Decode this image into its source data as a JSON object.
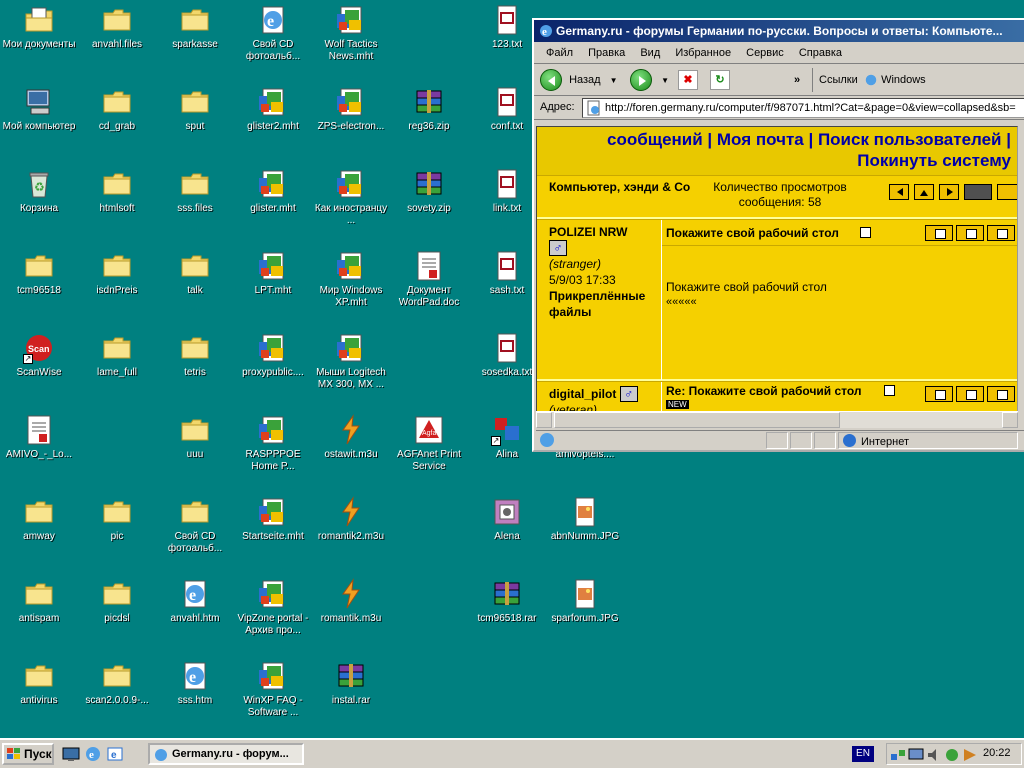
{
  "desktop": {
    "icons": [
      {
        "label": "Мои документы",
        "type": "mydocs"
      },
      {
        "label": "anvahl.files",
        "type": "folder"
      },
      {
        "label": "sparkasse",
        "type": "folder"
      },
      {
        "label": "Свой CD фотоальб...",
        "type": "ie"
      },
      {
        "label": "Wolf Tactics News.mht",
        "type": "mht"
      },
      {
        "label": "123.txt",
        "type": "txt"
      },
      {
        "label": "Мой компьютер",
        "type": "mycomp"
      },
      {
        "label": "cd_grab",
        "type": "folder"
      },
      {
        "label": "sput",
        "type": "folder"
      },
      {
        "label": "glister2.mht",
        "type": "mht"
      },
      {
        "label": "ZPS-electron...",
        "type": "mht"
      },
      {
        "label": "reg36.zip",
        "type": "rar"
      },
      {
        "label": "conf.txt",
        "type": "txt"
      },
      {
        "label": "Корзина",
        "type": "recycle"
      },
      {
        "label": "htmlsoft",
        "type": "folder"
      },
      {
        "label": "sss.files",
        "type": "folder"
      },
      {
        "label": "glister.mht",
        "type": "mht"
      },
      {
        "label": "Как иностранцу ...",
        "type": "mht"
      },
      {
        "label": "sovety.zip",
        "type": "rar"
      },
      {
        "label": "link.txt",
        "type": "txt"
      },
      {
        "label": "tcm96518",
        "type": "folder"
      },
      {
        "label": "isdnPreis",
        "type": "folder"
      },
      {
        "label": "talk",
        "type": "folder"
      },
      {
        "label": "LPT.mht",
        "type": "mht"
      },
      {
        "label": "Мир Windows XP.mht",
        "type": "mht"
      },
      {
        "label": "Документ WordPad.doc",
        "type": "doc"
      },
      {
        "label": "sash.txt",
        "type": "txt"
      },
      {
        "label": "ScanWise",
        "type": "scan"
      },
      {
        "label": "lame_full",
        "type": "folder"
      },
      {
        "label": "tetris",
        "type": "folder"
      },
      {
        "label": "proxypublic....",
        "type": "mht"
      },
      {
        "label": "Мыши Logitech MX 300, MX ...",
        "type": "mht"
      },
      {
        "label": "sosedka.txt",
        "type": "txt"
      },
      {
        "label": "AMIVO_-_Lo...",
        "type": "doc"
      },
      {
        "label": "uuu",
        "type": "folder"
      },
      {
        "label": "RASPPPOE Home P...",
        "type": "mht"
      },
      {
        "label": "ostawit.m3u",
        "type": "m3u"
      },
      {
        "label": "AGFAnet Print Service",
        "type": "agfa"
      },
      {
        "label": "Alina",
        "type": "alina"
      },
      {
        "label": "amivoptels....",
        "type": "txt"
      },
      {
        "label": "amway",
        "type": "folder"
      },
      {
        "label": "pic",
        "type": "folder"
      },
      {
        "label": "Свой CD фотоальб...",
        "type": "folder"
      },
      {
        "label": "Startseite.mht",
        "type": "mht"
      },
      {
        "label": "romantik2.m3u",
        "type": "m3u"
      },
      {
        "label": "Alena",
        "type": "alena"
      },
      {
        "label": "abnNumm.JPG",
        "type": "jpg"
      },
      {
        "label": "antispam",
        "type": "folder"
      },
      {
        "label": "picdsl",
        "type": "folder"
      },
      {
        "label": "anvahl.htm",
        "type": "ie"
      },
      {
        "label": "VipZone portal - Архив про...",
        "type": "mht"
      },
      {
        "label": "romantik.m3u",
        "type": "m3u"
      },
      {
        "label": "tcm96518.rar",
        "type": "rar"
      },
      {
        "label": "sparforum.JPG",
        "type": "jpg"
      },
      {
        "label": "antivirus",
        "type": "folder"
      },
      {
        "label": "scan2.0.0.9-...",
        "type": "folder"
      },
      {
        "label": "sss.htm",
        "type": "ie"
      },
      {
        "label": "WinXP FAQ - Software ...",
        "type": "mht"
      },
      {
        "label": "instal.rar",
        "type": "rar"
      }
    ]
  },
  "browser": {
    "title": "Germany.ru - форумы Германии по-русски. Вопросы и ответы: Компьюте...",
    "menu": [
      "Файл",
      "Правка",
      "Вид",
      "Избранное",
      "Сервис",
      "Справка"
    ],
    "toolbar": {
      "back_label": "Назад",
      "links_label": "Ссылки",
      "windows_label": "Windows",
      "more": "»"
    },
    "address": {
      "label": "Адрес:",
      "url": "http://foren.germany.ru/computer/f/987071.html?Cat=&page=0&view=collapsed&sb="
    },
    "page": {
      "header_line1": "сообщений | Моя почта | Поиск пользователей |",
      "header_line2": "Покинуть систему",
      "thread_title": "Компьютер, хэнди & Co",
      "views": "Количество просмотров сообщения: 58",
      "post1": {
        "author": "POLIZEI NRW",
        "status": "(stranger)",
        "date": "5/9/03 17:33",
        "attachments": "Прикреплённые файлы",
        "subject": "Покажите свой рабочий стол",
        "body": "Покажите свой рабочий стол",
        "body2": "«««««"
      },
      "post2": {
        "author": "digital_pilot",
        "status": "(veteran)",
        "subject": "Re: Покажите свой рабочий стол",
        "new_badge": "NEW"
      }
    },
    "status": {
      "zone": "Интернет"
    }
  },
  "taskbar": {
    "start_label": "Пуск",
    "task_label": "Germany.ru - форум...",
    "lang": "EN",
    "clock": "20:22"
  }
}
